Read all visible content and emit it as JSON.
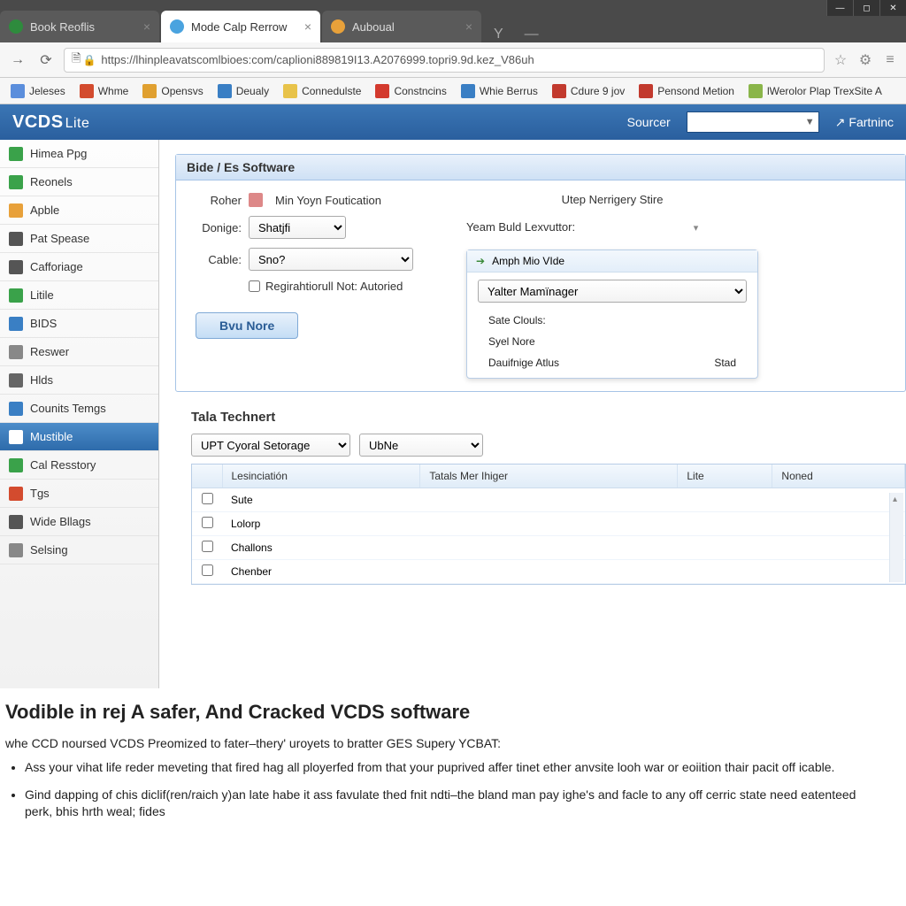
{
  "window": {
    "tabs": [
      {
        "title": "Book Reoflis",
        "active": false,
        "color": "#2e8b3d"
      },
      {
        "title": "Mode Calp Rerrow",
        "active": true,
        "color": "#4aa3df"
      },
      {
        "title": "Auboual",
        "active": false,
        "color": "#e8a13a"
      }
    ]
  },
  "url": "https://lhinpleavatscomlbioes:com/caplioni889819I13.A2076999.topri9.9d.kez_V86uh",
  "bookmarks": [
    {
      "label": "Jeleses",
      "color": "#5b8edc"
    },
    {
      "label": "Whme",
      "color": "#d34b2e"
    },
    {
      "label": "Opensvs",
      "color": "#e0a030"
    },
    {
      "label": "Deualy",
      "color": "#3a7fc4"
    },
    {
      "label": "Connedulste",
      "color": "#e8c34a"
    },
    {
      "label": "Constncins",
      "color": "#d33a2e"
    },
    {
      "label": "Whie Berrus",
      "color": "#3a7fc4"
    },
    {
      "label": "Cdure 9 jov",
      "color": "#c23a2e"
    },
    {
      "label": "Pensond Metion",
      "color": "#c23a2e"
    },
    {
      "label": "lWerolor Plap TrexSite A",
      "color": "#8ab54a"
    }
  ],
  "app": {
    "logo_main": "VCDS",
    "logo_suffix": "Lite",
    "sourcer_label": "Sourcer",
    "launch_label": "Fartninc"
  },
  "sidebar": {
    "items": [
      {
        "label": "Himea Ppg",
        "color": "#3aa24a"
      },
      {
        "label": "Reonels",
        "color": "#3aa24a"
      },
      {
        "label": "Apble",
        "color": "#e8a13a"
      },
      {
        "label": "Pat Spease",
        "color": "#555"
      },
      {
        "label": "Cafforiage",
        "color": "#555"
      },
      {
        "label": "Litile",
        "color": "#3aa24a"
      },
      {
        "label": "BIDS",
        "color": "#3a7fc4"
      },
      {
        "label": "Reswer",
        "color": "#888"
      },
      {
        "label": "Hlds",
        "color": "#666"
      },
      {
        "label": "Counits Temgs",
        "color": "#3a7fc4"
      },
      {
        "label": "Mustible",
        "color": "#fff",
        "active": true
      },
      {
        "label": "Cal Resstory",
        "color": "#3aa24a"
      },
      {
        "label": "Tgs",
        "color": "#d34b2e"
      },
      {
        "label": "Wide Bllags",
        "color": "#555"
      },
      {
        "label": "Selsing",
        "color": "#888"
      }
    ]
  },
  "panel": {
    "title": "Bide / Es Software",
    "left": {
      "roher_label": "Roher",
      "roher_after": "Min Yoyn  Foutication",
      "donige_label": "Donige:",
      "donige_value": "Shatjfi",
      "cable_label": "Cable:",
      "cable_value": "Sno?",
      "checkbox_label": "Regirahtiorull Not: Autoried",
      "button": "Bvu Nore"
    },
    "right": {
      "header": "Utep Nerrigery Stire",
      "label2": "Yeam Buld  Lexvuttor:",
      "popup_title": "Amph Mio VIde",
      "select_value": "Yalter Mamïnager",
      "rows": [
        "Sate Clouls:",
        "Syel Nore"
      ],
      "last_row_left": "Dauifnige Atlus",
      "last_row_right": "Stad"
    }
  },
  "section2": {
    "title": "Tala Technert",
    "toolbar_sel1": "UPT Cyoral Setorage",
    "toolbar_sel2": "UbNe",
    "columns": [
      "",
      "Lesinciatión",
      "Tatals Mer Ihiger",
      "Lite",
      "Noned"
    ],
    "rows": [
      "Sute",
      "Lolorp",
      "Challons",
      "Chenber"
    ]
  },
  "article": {
    "heading": "Vodible in rej A safer, And Cracked VCDS software",
    "para": "whe CCD noursed VCDS Preomized to fater–thery' uroyets to bratter GES Supery YCBAT:",
    "bullets": [
      "Ass your vihat life reder meveting that fired hag all ployerfed from that your puprived affer tinet ether anvsite looh war or eoiition thair pacit off icable.",
      "Gind dapping of chis diclif(ren/raich y)an late habe it ass favulate thed fnit ndti–the bland man pay ighe's and facle to any off cerric state need eatenteed perk, bhis hrth weal; fides"
    ]
  }
}
